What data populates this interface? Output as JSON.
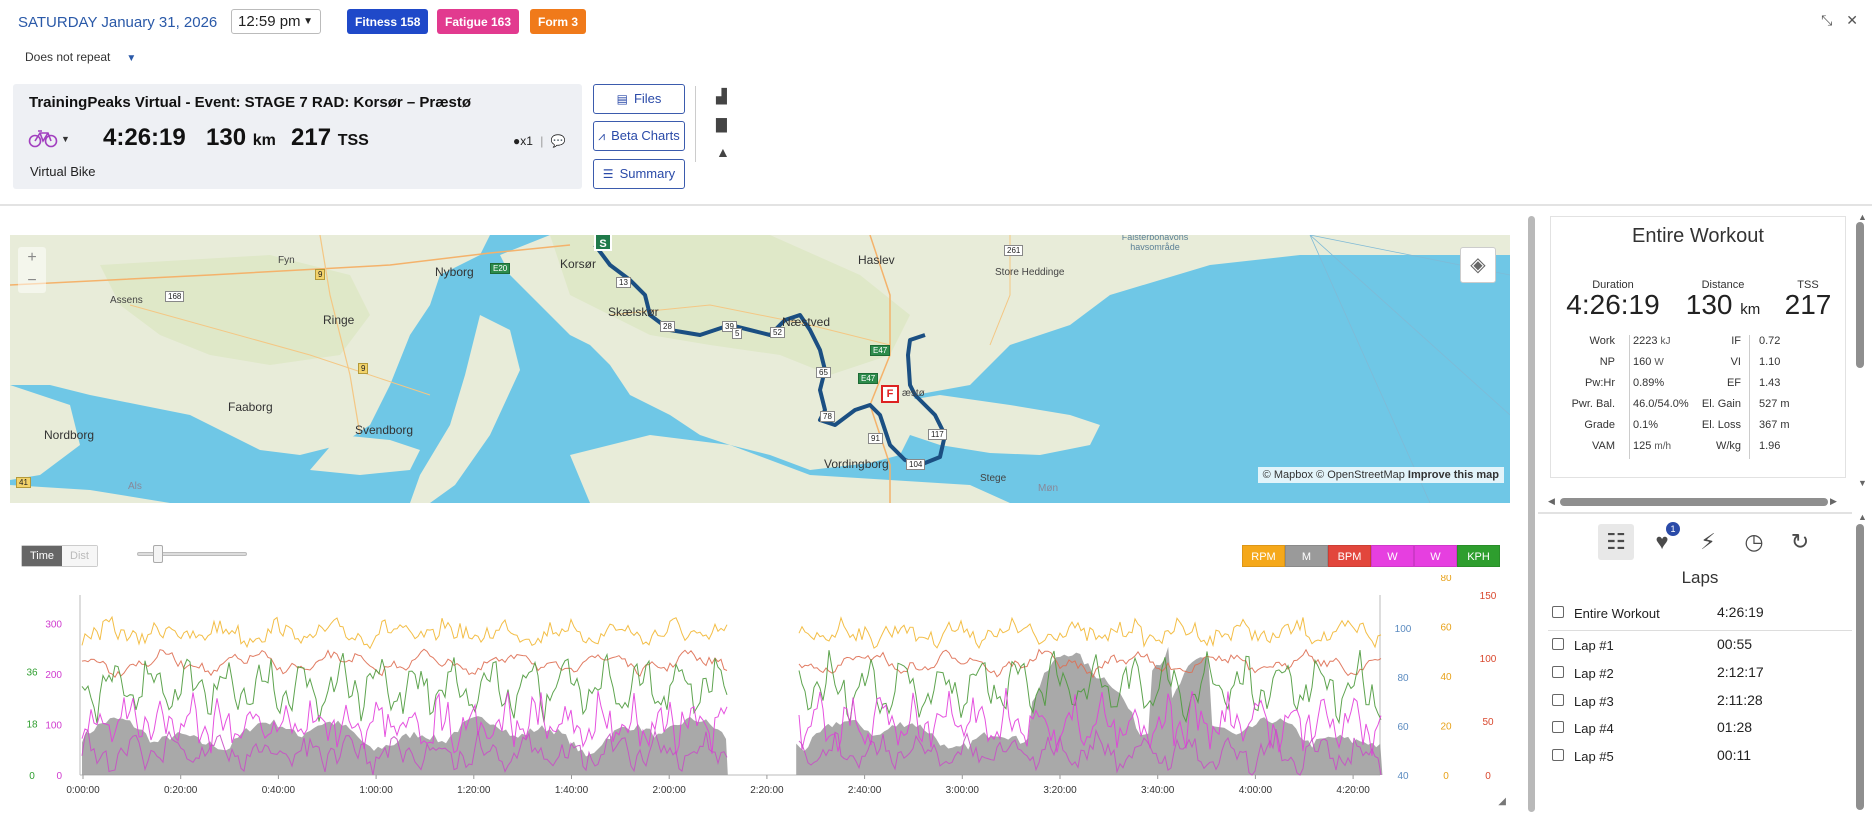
{
  "header": {
    "date": "SATURDAY January 31, 2026",
    "time": "12:59 pm",
    "repeat": "Does not repeat",
    "badges": [
      {
        "label": "Fitness 158",
        "color": "#1f49c9"
      },
      {
        "label": "Fatigue 163",
        "color": "#e23a8f"
      },
      {
        "label": "Form 3",
        "color": "#f07a1a"
      }
    ]
  },
  "workout": {
    "title": "TrainingPeaks Virtual - Event: STAGE 7 RAD: Korsør – Præstø",
    "duration": "4:26:19",
    "distance_value": "130",
    "distance_unit": "km",
    "tss_value": "217",
    "tss_unit": "TSS",
    "sport": "Virtual Bike",
    "equipment_count": "x1",
    "sport_color": "#a23fbf"
  },
  "buttons": {
    "files": "Files",
    "beta_charts": "Beta Charts",
    "summary": "Summary"
  },
  "map": {
    "labels": {
      "fyn": "Fyn",
      "nyborg": "Nyborg",
      "korsor": "Korsør",
      "haslev": "Haslev",
      "assens": "Assens",
      "ringe": "Ringe",
      "skaelskor": "Skælskør",
      "naestved": "Næstved",
      "store_heddinge": "Store Heddinge",
      "faaborg": "Faaborg",
      "svendborg": "Svendborg",
      "praesto": "æstø",
      "nordborg": "Nordborg",
      "vordingborg": "Vordingborg",
      "stege": "Stege",
      "als": "Als",
      "mon": "Møn",
      "falsterbo": "Falsterbohavons havsområde"
    },
    "roads": [
      "E20",
      "9",
      "168",
      "13",
      "28",
      "39",
      "5",
      "52",
      "E47",
      "65",
      "E47",
      "78",
      "91",
      "117",
      "104",
      "261",
      "9",
      "41"
    ],
    "start_marker": "S",
    "finish_marker": "F",
    "attribution_mapbox": "© Mapbox",
    "attribution_osm": "© OpenStreetMap",
    "attribution_improve": "Improve this map"
  },
  "chart": {
    "toggle_time": "Time",
    "toggle_dist": "Dist",
    "legend": [
      {
        "label": "RPM",
        "color": "#f5a81a"
      },
      {
        "label": "M",
        "color": "#9a9a9a"
      },
      {
        "label": "BPM",
        "color": "#e2463c"
      },
      {
        "label": "W",
        "color": "#e63fe0"
      },
      {
        "label": "W",
        "color": "#e63fe0"
      },
      {
        "label": "KPH",
        "color": "#2e9e2e"
      }
    ]
  },
  "chart_data": {
    "type": "line",
    "x_ticks": [
      "0:00:00",
      "0:20:00",
      "0:40:00",
      "1:00:00",
      "1:20:00",
      "1:40:00",
      "2:00:00",
      "2:20:00",
      "2:40:00",
      "3:00:00",
      "3:20:00",
      "3:40:00",
      "4:00:00",
      "4:20:00"
    ],
    "axes": {
      "kph": {
        "ticks": [
          "0",
          "18",
          "36"
        ],
        "color": "#2e9e2e"
      },
      "watts": {
        "ticks": [
          "0",
          "100",
          "200",
          "300"
        ],
        "color": "#d03bcf"
      },
      "elevation": {
        "ticks": [
          "40",
          "60",
          "80",
          "100"
        ],
        "color": "#5b8bc0"
      },
      "rpm": {
        "ticks": [
          "0",
          "20",
          "40",
          "60",
          "80"
        ],
        "color": "#e8a21a"
      },
      "bpm": {
        "ticks": [
          "50",
          "100",
          "150"
        ],
        "color": "#d9482e"
      }
    },
    "gap_range": [
      "2:12",
      "2:32"
    ],
    "series": [
      {
        "key": "cadence",
        "color": "#f2b733"
      },
      {
        "key": "heart_rate",
        "color": "#de6e52"
      },
      {
        "key": "speed",
        "color": "#4d9a3c"
      },
      {
        "key": "power",
        "color": "#e23fdc"
      },
      {
        "key": "power_avg",
        "color": "#c84fc5"
      },
      {
        "key": "elevation",
        "color": "#8a8a8a"
      }
    ]
  },
  "summary": {
    "title": "Entire Workout",
    "duration_label": "Duration",
    "duration": "4:26:19",
    "distance_label": "Distance",
    "distance": "130",
    "distance_unit": "km",
    "tss_label": "TSS",
    "tss": "217",
    "left_metrics": [
      {
        "name": "Work",
        "value": "2223",
        "unit": "kJ"
      },
      {
        "name": "NP",
        "value": "160",
        "unit": "W"
      },
      {
        "name": "Pw:Hr",
        "value": "0.89%",
        "unit": ""
      },
      {
        "name": "Pwr. Bal.",
        "value": "46.0/54.0%",
        "unit": ""
      },
      {
        "name": "Grade",
        "value": "0.1%",
        "unit": ""
      },
      {
        "name": "VAM",
        "value": "125",
        "unit": "m/h"
      }
    ],
    "right_metrics": [
      {
        "name": "IF",
        "value": "0.72",
        "unit": ""
      },
      {
        "name": "VI",
        "value": "1.10",
        "unit": ""
      },
      {
        "name": "EF",
        "value": "1.43",
        "unit": ""
      },
      {
        "name": "El. Gain",
        "value": "527",
        "unit": "m"
      },
      {
        "name": "El. Loss",
        "value": "367",
        "unit": "m"
      },
      {
        "name": "W/kg",
        "value": "1.96",
        "unit": ""
      }
    ]
  },
  "laps": {
    "title": "Laps",
    "heart_badge": "1",
    "rows": [
      {
        "name": "Entire Workout",
        "duration": "4:26:19"
      },
      {
        "name": "Lap #1",
        "duration": "00:55"
      },
      {
        "name": "Lap #2",
        "duration": "2:12:17"
      },
      {
        "name": "Lap #3",
        "duration": "2:11:28"
      },
      {
        "name": "Lap #4",
        "duration": "01:28"
      },
      {
        "name": "Lap #5",
        "duration": "00:11"
      }
    ]
  }
}
